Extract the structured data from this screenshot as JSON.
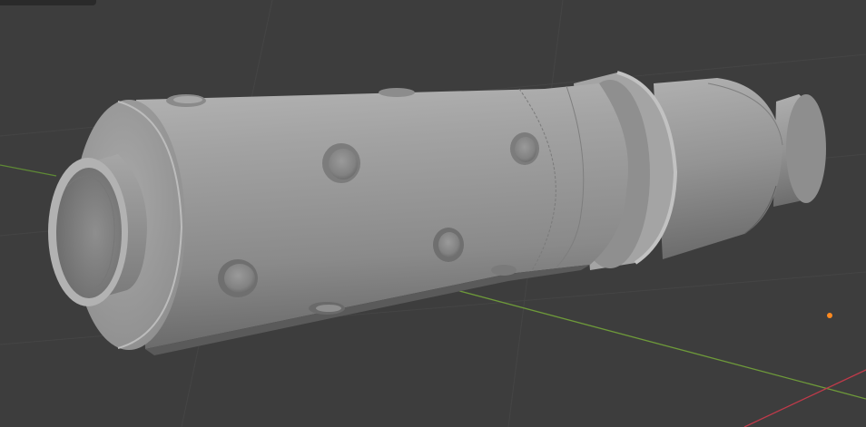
{
  "app": {
    "name": "",
    "editor": "3D Viewport"
  },
  "viewport": {
    "background_color": "#3d3d3d",
    "grid_line_color": "#464646",
    "x_axis_color": "#c03a4a",
    "y_axis_color": "#6e9a3a",
    "object_color": "#9c9c9c",
    "light_color": "#ff8a1f"
  },
  "scene": {
    "object": {
      "type": "cylindrical-part",
      "features": [
        "front-collar",
        "vent-holes",
        "rear-flange",
        "rear-step"
      ]
    },
    "light": {
      "type": "point-light-origin"
    }
  }
}
